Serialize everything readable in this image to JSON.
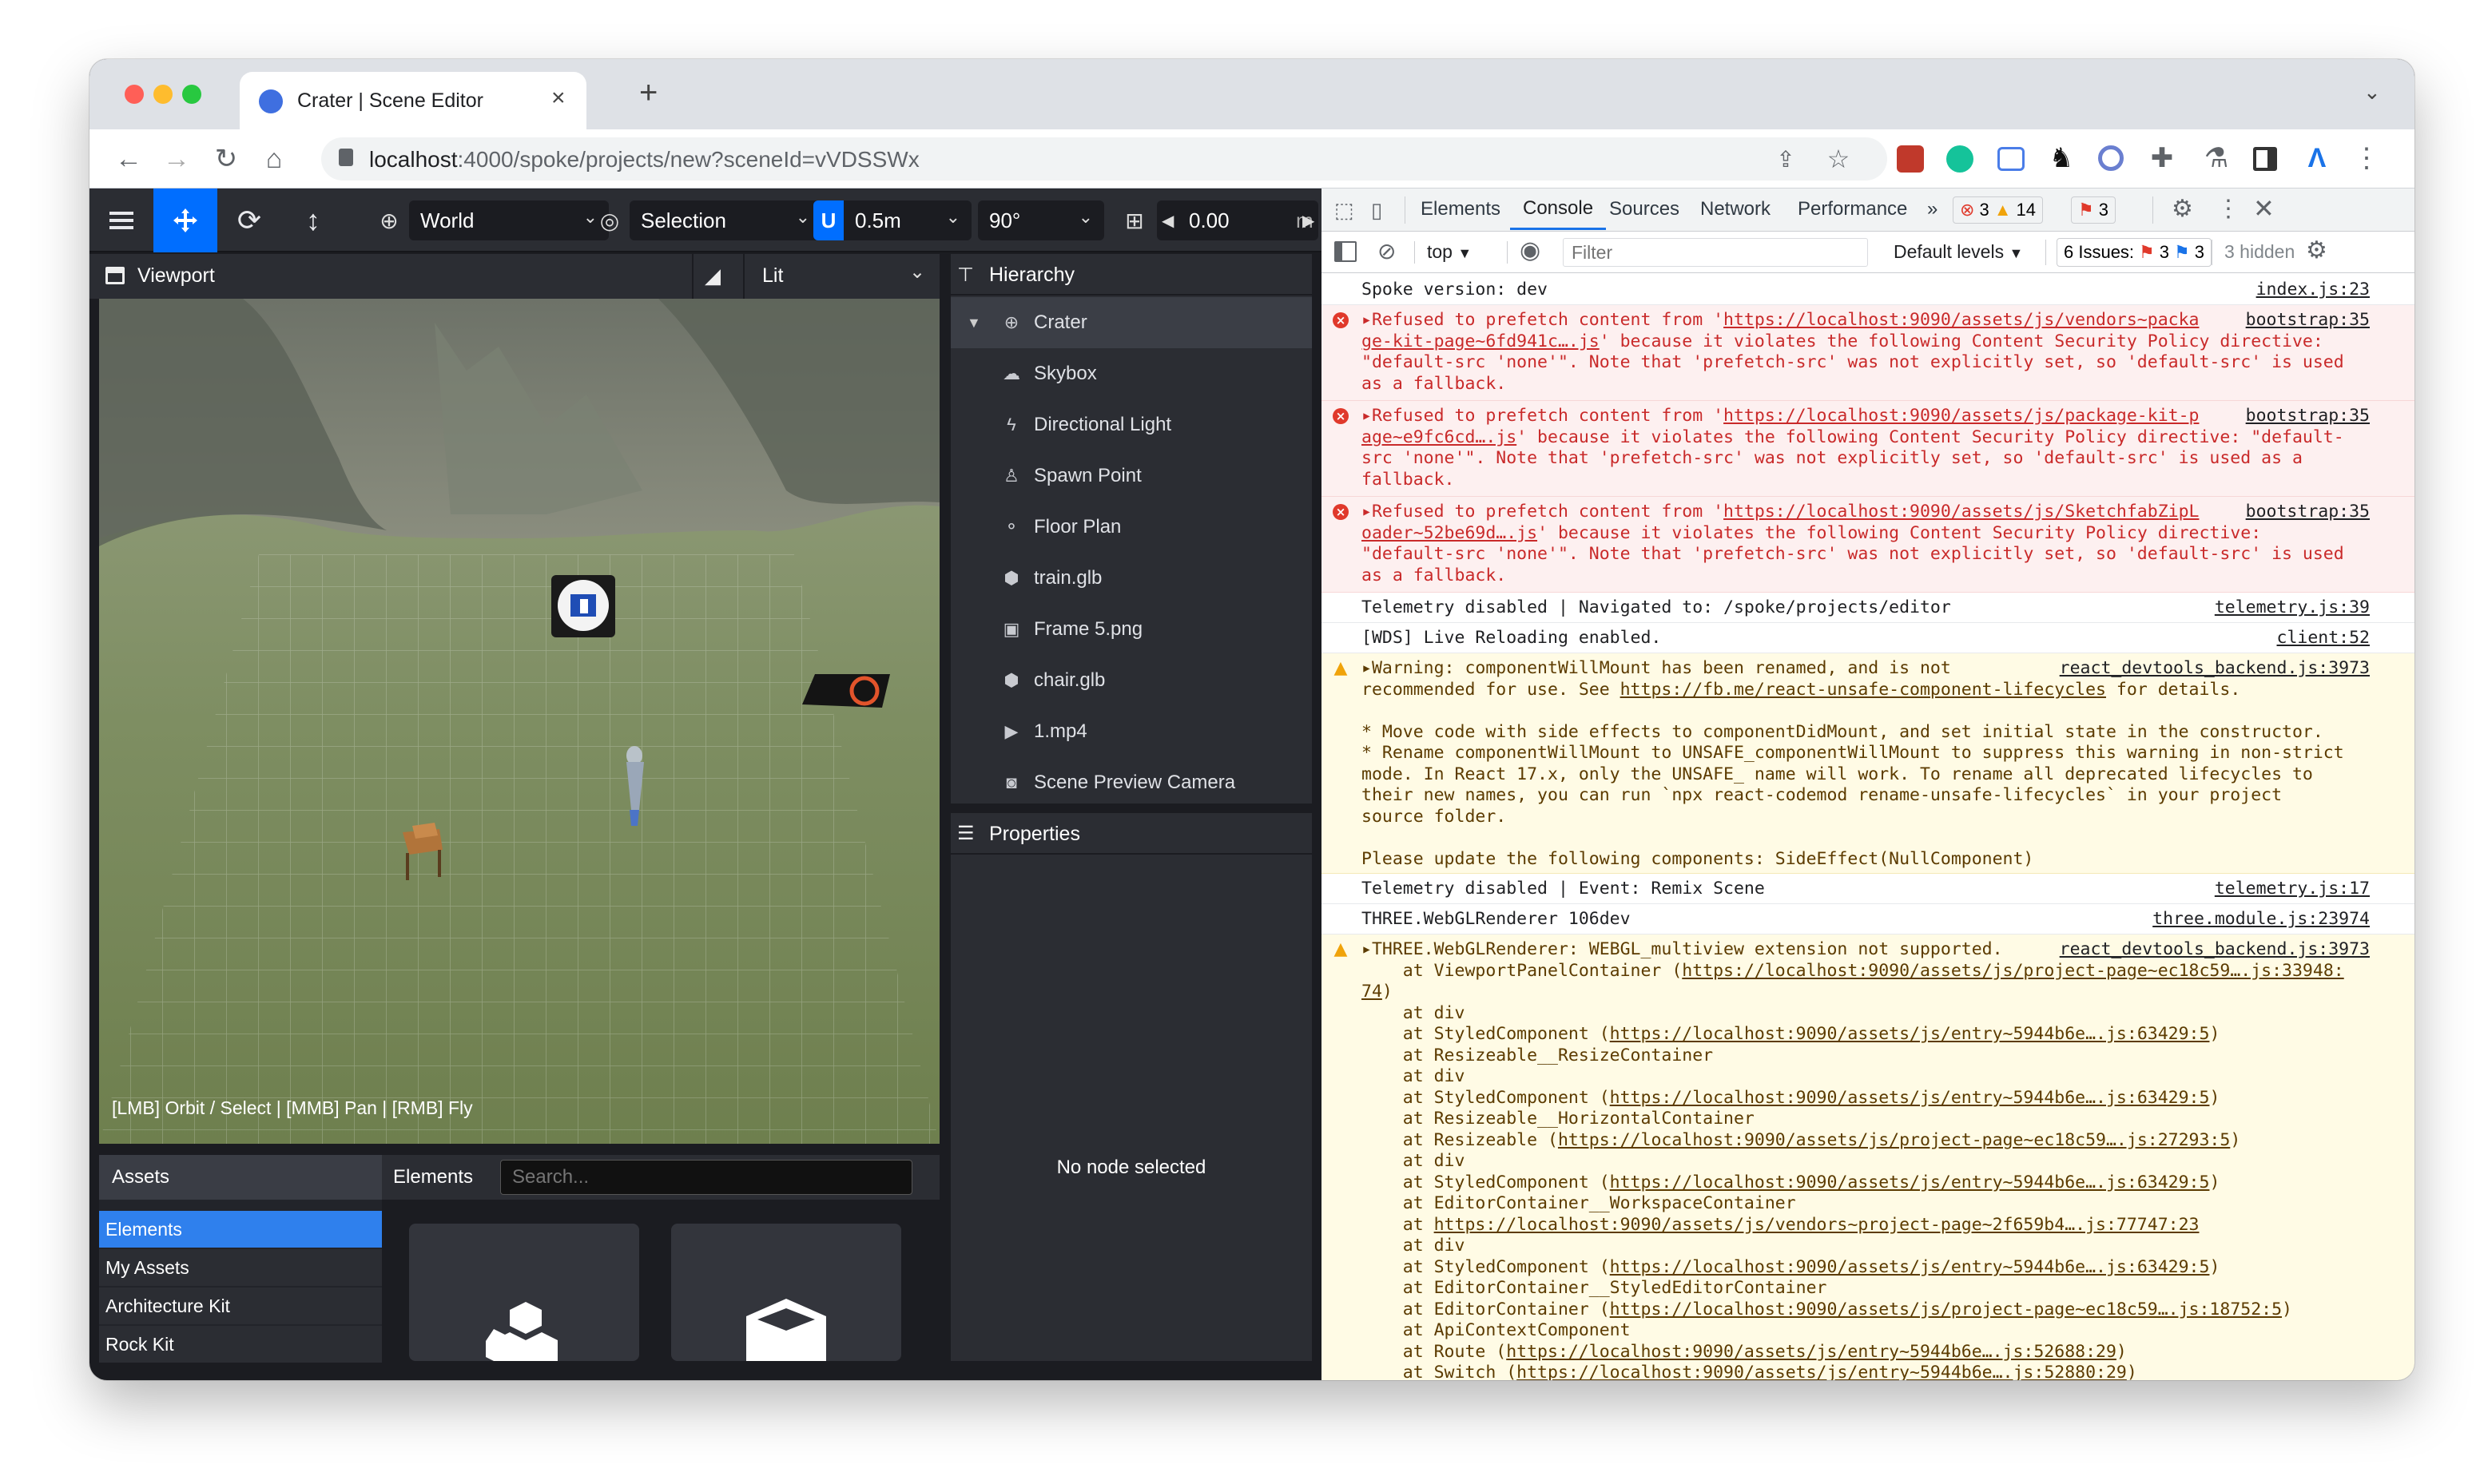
{
  "browser": {
    "tab_title": "Crater | Scene Editor",
    "url_host": "localhost",
    "url_path": ":4000/spoke/projects/new?sceneId=vVDSSWx",
    "new_tab_label": "+"
  },
  "toolbar": {
    "transform_space": "World",
    "pivot": "Selection",
    "snap_translate": "0.5m",
    "snap_rotate": "90°",
    "grid_height": "0.00",
    "grid_unit": "m"
  },
  "viewport": {
    "title": "Viewport",
    "render_mode": "Lit",
    "hint": "[LMB] Orbit / Select | [MMB] Pan | [RMB] Fly"
  },
  "hierarchy": {
    "title": "Hierarchy",
    "root": "Crater",
    "items": [
      {
        "label": "Skybox",
        "icon": "cloud-icon"
      },
      {
        "label": "Directional Light",
        "icon": "bolt-icon"
      },
      {
        "label": "Spawn Point",
        "icon": "person-icon"
      },
      {
        "label": "Floor Plan",
        "icon": "shoe-prints-icon"
      },
      {
        "label": "train.glb",
        "icon": "cube-icon"
      },
      {
        "label": "Frame 5.png",
        "icon": "image-icon"
      },
      {
        "label": "chair.glb",
        "icon": "cube-icon"
      },
      {
        "label": "1.mp4",
        "icon": "video-icon"
      },
      {
        "label": "Scene Preview Camera",
        "icon": "camera-icon"
      }
    ]
  },
  "properties": {
    "title": "Properties",
    "empty": "No node selected"
  },
  "assets": {
    "title": "Assets",
    "elements_label": "Elements",
    "search_placeholder": "Search...",
    "sources": [
      "Elements",
      "My Assets",
      "Architecture Kit",
      "Rock Kit"
    ]
  },
  "devtools": {
    "tabs": [
      "Elements",
      "Console",
      "Sources",
      "Network",
      "Performance"
    ],
    "more": "»",
    "badge_errors": "3",
    "badge_warnings": "14",
    "badge_issues": "3",
    "context": "top",
    "filter_placeholder": "Filter",
    "levels": "Default levels",
    "issues_label": "6 Issues:",
    "issues_err": "3",
    "issues_info": "3",
    "hidden": "3 hidden",
    "colors": {
      "error": "#e0392b",
      "warning": "#f0a30a",
      "accent": "#1a73e8"
    }
  },
  "console": {
    "l1": {
      "text": "Spoke version: dev",
      "src": "index.js:23"
    },
    "e1": {
      "text": "▸Refused to prefetch content from '",
      "link": "https://localhost:9090/assets/js/vendors~packa",
      "src": "bootstrap:35",
      "l2a": "ge-kit-page~6fd941c….js",
      "l2b": "' because it violates the following Content Security Policy directive:",
      "l3": "\"default-src 'none'\". Note that 'prefetch-src' was not explicitly set, so 'default-src' is used",
      "l4": "as a fallback."
    },
    "e2": {
      "text": "▸Refused to prefetch content from '",
      "link": "https://localhost:9090/assets/js/package-kit-p",
      "src": "bootstrap:35",
      "l2a": "age~e9fc6cd….js",
      "l2b": "' because it violates the following Content Security Policy directive: \"default-",
      "l3": "src 'none'\". Note that 'prefetch-src' was not explicitly set, so 'default-src' is used as a",
      "l4": "fallback."
    },
    "e3": {
      "text": "▸Refused to prefetch content from '",
      "link": "https://localhost:9090/assets/js/SketchfabZipL",
      "src": "bootstrap:35",
      "l2a": "oader~52be69d….js",
      "l2b": "' because it violates the following Content Security Policy directive:",
      "l3": "\"default-src 'none'\". Note that 'prefetch-src' was not explicitly set, so 'default-src' is used",
      "l4": "as a fallback."
    },
    "l2": {
      "text": "Telemetry disabled | Navigated to: /spoke/projects/editor",
      "src": "telemetry.js:39"
    },
    "l3": {
      "text": "[WDS] Live Reloading enabled.",
      "src": "client:52"
    },
    "w1": {
      "src": "react_devtools_backend.js:3973",
      "lines": [
        "▸Warning: componentWillMount has been renamed, and is not",
        "recommended for use. See ",
        "",
        "* Move code with side effects to componentDidMount, and set initial state in the constructor.",
        "* Rename componentWillMount to UNSAFE_componentWillMount to suppress this warning in non-strict",
        "mode. In React 17.x, only the UNSAFE_ name will work. To rename all deprecated lifecycles to",
        "their new names, you can run `npx react-codemod rename-unsafe-lifecycles` in your project",
        "source folder.",
        "",
        "Please update the following components: SideEffect(NullComponent)"
      ],
      "link": "https://fb.me/react-unsafe-component-lifecycles",
      "after": " for details."
    },
    "l4": {
      "text": "Telemetry disabled | Event: Remix Scene",
      "src": "telemetry.js:17"
    },
    "l5": {
      "text": "THREE.WebGLRenderer 106dev",
      "src": "three.module.js:23974"
    },
    "w2": {
      "head": "▸THREE.WebGLRenderer: WEBGL_multiview extension not supported.",
      "src": "react_devtools_backend.js:3973",
      "stack": [
        [
          "    at ViewportPanelContainer (",
          "https://localhost:9090/assets/js/project-page~ec18c59….js:33948:",
          ""
        ],
        [
          "",
          "74",
          ")"
        ],
        [
          "    at div",
          "",
          ""
        ],
        [
          "    at StyledComponent (",
          "https://localhost:9090/assets/js/entry~5944b6e….js:63429:5",
          ")"
        ],
        [
          "    at Resizeable__ResizeContainer",
          "",
          ""
        ],
        [
          "    at div",
          "",
          ""
        ],
        [
          "    at StyledComponent (",
          "https://localhost:9090/assets/js/entry~5944b6e….js:63429:5",
          ")"
        ],
        [
          "    at Resizeable__HorizontalContainer",
          "",
          ""
        ],
        [
          "    at Resizeable (",
          "https://localhost:9090/assets/js/project-page~ec18c59….js:27293:5",
          ")"
        ],
        [
          "    at div",
          "",
          ""
        ],
        [
          "    at StyledComponent (",
          "https://localhost:9090/assets/js/entry~5944b6e….js:63429:5",
          ")"
        ],
        [
          "    at EditorContainer__WorkspaceContainer",
          "",
          ""
        ],
        [
          "    at ",
          "https://localhost:9090/assets/js/vendors~project-page~2f659b4….js:77747:23",
          ""
        ],
        [
          "    at div",
          "",
          ""
        ],
        [
          "    at StyledComponent (",
          "https://localhost:9090/assets/js/entry~5944b6e….js:63429:5",
          ")"
        ],
        [
          "    at EditorContainer__StyledEditorContainer",
          "",
          ""
        ],
        [
          "    at EditorContainer (",
          "https://localhost:9090/assets/js/project-page~ec18c59….js:18752:5",
          ")"
        ],
        [
          "    at ApiContextComponent",
          "",
          ""
        ],
        [
          "    at Route (",
          "https://localhost:9090/assets/js/entry~5944b6e….js:52688:29",
          ")"
        ],
        [
          "    at Switch (",
          "https://localhost:9090/assets/js/entry~5944b6e….js:52880:29",
          ")"
        ]
      ]
    }
  }
}
